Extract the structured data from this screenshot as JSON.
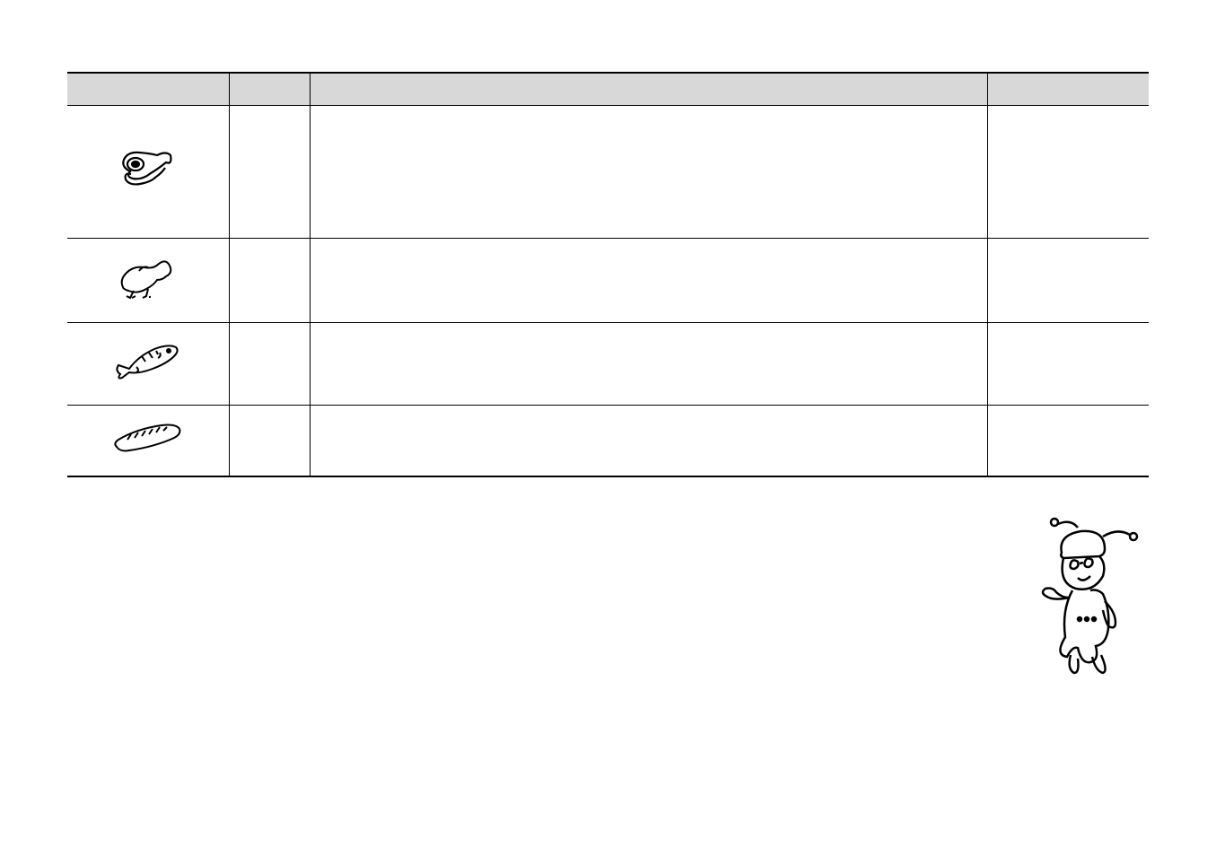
{
  "table": {
    "columns": [
      "",
      "",
      "",
      ""
    ],
    "rows": [
      {
        "icon": "steak-icon",
        "c2": "",
        "c3": "",
        "c4": ""
      },
      {
        "icon": "chicken-icon",
        "c2": "",
        "c3": "",
        "c4": ""
      },
      {
        "icon": "fish-icon",
        "c2": "",
        "c3": "",
        "c4": ""
      },
      {
        "icon": "bread-icon",
        "c2": "",
        "c3": "",
        "c4": ""
      }
    ]
  },
  "mascot": "character-mascot"
}
